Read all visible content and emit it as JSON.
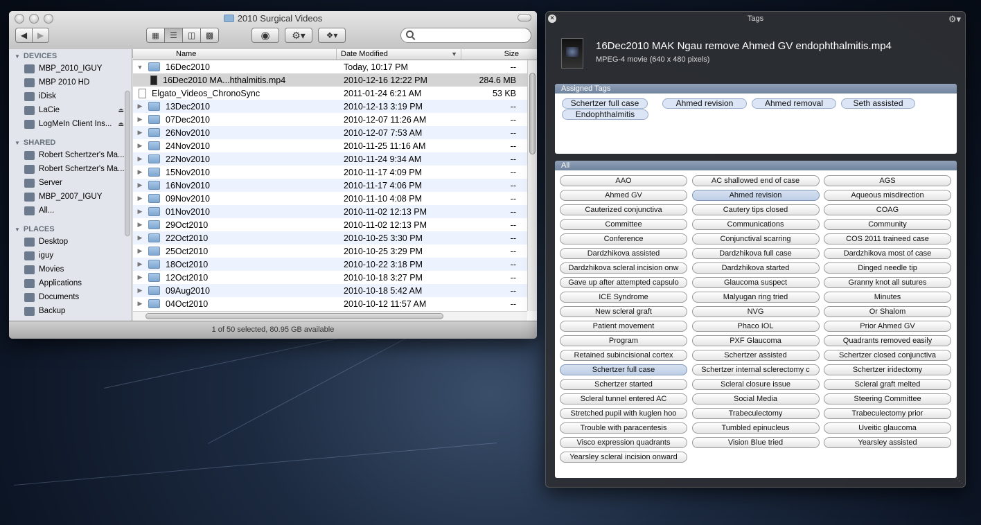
{
  "finder": {
    "title": "2010 Surgical Videos",
    "view_buttons": [
      "icon-view",
      "list-view",
      "column-view",
      "coverflow-view"
    ],
    "search_placeholder": "",
    "sidebar": {
      "devices_header": "DEVICES",
      "devices": [
        {
          "label": "MBP_2010_IGUY",
          "icon": "laptop-icon"
        },
        {
          "label": "MBP 2010 HD",
          "icon": "harddisk-icon"
        },
        {
          "label": "iDisk",
          "icon": "idisk-icon"
        },
        {
          "label": "LaCie",
          "icon": "external-disk-icon",
          "eject": true
        },
        {
          "label": "LogMeIn Client Ins...",
          "icon": "disk-image-icon",
          "eject": true
        }
      ],
      "shared_header": "SHARED",
      "shared": [
        {
          "label": "Robert Schertzer's Ma...",
          "icon": "computer-icon"
        },
        {
          "label": "Robert Schertzer's Ma...",
          "icon": "computer-icon"
        },
        {
          "label": "Server",
          "icon": "server-icon"
        },
        {
          "label": "MBP_2007_IGUY",
          "icon": "laptop-icon"
        },
        {
          "label": "All...",
          "icon": "network-icon"
        }
      ],
      "places_header": "PLACES",
      "places": [
        {
          "label": "Desktop",
          "icon": "desktop-icon"
        },
        {
          "label": "iguy",
          "icon": "home-icon"
        },
        {
          "label": "Movies",
          "icon": "movies-icon"
        },
        {
          "label": "Applications",
          "icon": "applications-icon"
        },
        {
          "label": "Documents",
          "icon": "documents-icon"
        },
        {
          "label": "Backup",
          "icon": "folder-icon"
        }
      ]
    },
    "columns": {
      "name": "Name",
      "date": "Date Modified",
      "size": "Size"
    },
    "rows": [
      {
        "name": "16Dec2010",
        "date": "Today, 10:17 PM",
        "size": "--",
        "type": "folder",
        "expanded": true
      },
      {
        "name": "16Dec2010 MA...hthalmitis.mp4",
        "date": "2010-12-16 12:22 PM",
        "size": "284.6 MB",
        "type": "movie",
        "selected": true
      },
      {
        "name": "Elgato_Videos_ChronoSync",
        "date": "2011-01-24 6:21 AM",
        "size": "53 KB",
        "type": "file"
      },
      {
        "name": "13Dec2010",
        "date": "2010-12-13 3:19 PM",
        "size": "--",
        "type": "folder"
      },
      {
        "name": "07Dec2010",
        "date": "2010-12-07 11:26 AM",
        "size": "--",
        "type": "folder"
      },
      {
        "name": "26Nov2010",
        "date": "2010-12-07 7:53 AM",
        "size": "--",
        "type": "folder"
      },
      {
        "name": "24Nov2010",
        "date": "2010-11-25 11:16 AM",
        "size": "--",
        "type": "folder"
      },
      {
        "name": "22Nov2010",
        "date": "2010-11-24 9:34 AM",
        "size": "--",
        "type": "folder"
      },
      {
        "name": "15Nov2010",
        "date": "2010-11-17 4:09 PM",
        "size": "--",
        "type": "folder"
      },
      {
        "name": "16Nov2010",
        "date": "2010-11-17 4:06 PM",
        "size": "--",
        "type": "folder"
      },
      {
        "name": "09Nov2010",
        "date": "2010-11-10 4:08 PM",
        "size": "--",
        "type": "folder"
      },
      {
        "name": "01Nov2010",
        "date": "2010-11-02 12:13 PM",
        "size": "--",
        "type": "folder"
      },
      {
        "name": "29Oct2010",
        "date": "2010-11-02 12:13 PM",
        "size": "--",
        "type": "folder"
      },
      {
        "name": "22Oct2010",
        "date": "2010-10-25 3:30 PM",
        "size": "--",
        "type": "folder"
      },
      {
        "name": "25Oct2010",
        "date": "2010-10-25 3:29 PM",
        "size": "--",
        "type": "folder"
      },
      {
        "name": "18Oct2010",
        "date": "2010-10-22 3:18 PM",
        "size": "--",
        "type": "folder"
      },
      {
        "name": "12Oct2010",
        "date": "2010-10-18 3:27 PM",
        "size": "--",
        "type": "folder"
      },
      {
        "name": "09Aug2010",
        "date": "2010-10-18 5:42 AM",
        "size": "--",
        "type": "folder"
      },
      {
        "name": "04Oct2010",
        "date": "2010-10-12 11:57 AM",
        "size": "--",
        "type": "folder"
      }
    ],
    "status": "1 of 50 selected, 80.95 GB available"
  },
  "tags_panel": {
    "title": "Tags",
    "file_name": "16Dec2010 MAK Ngau remove Ahmed GV endophthalmitis.mp4",
    "file_type": "MPEG-4 movie (640 x 480 pixels)",
    "assigned_header": "Assigned Tags",
    "assigned": [
      "Schertzer full case",
      "Ahmed revision",
      "Ahmed removal",
      "Seth assisted",
      "Endophthalmitis"
    ],
    "all_header": "All",
    "all_tags": [
      "AAO",
      "AC shallowed end of case",
      "AGS",
      "Ahmed GV",
      "Ahmed revision",
      "Aqueous misdirection",
      "Cauterized conjunctiva",
      "Cautery tips closed",
      "COAG",
      "Committee",
      "Communications",
      "Community",
      "Conference",
      "Conjunctival scarring",
      "COS 2011 traineed case",
      "Dardzhikova assisted",
      "Dardzhikova full case",
      "Dardzhikova most of case",
      "Dardzhikova scleral incision onw",
      "Dardzhikova started",
      "Dinged needle tip",
      "Gave up after attempted capsulo",
      "Glaucoma suspect",
      "Granny knot all sutures",
      "ICE Syndrome",
      "Malyugan ring tried",
      "Minutes",
      "New scleral graft",
      "NVG",
      "Or Shalom",
      "Patient movement",
      "Phaco IOL",
      "Prior Ahmed GV",
      "Program",
      "PXF Glaucoma",
      "Quadrants removed easily",
      "Retained subincisional cortex",
      "Schertzer assisted",
      "Schertzer closed conjunctiva",
      "Schertzer full case",
      "Schertzer internal sclerectomy c",
      "Schertzer iridectomy",
      "Schertzer started",
      "Scleral closure issue",
      "Scleral graft melted",
      "Scleral tunnel entered AC",
      "Social Media",
      "Steering Committee",
      "Stretched pupil with kuglen hoo",
      "Trabeculectomy",
      "Trabeculectomy prior",
      "Trouble with paracentesis",
      "Tumbled epinucleus",
      "Uveitic glaucoma",
      "Visco expression quadrants",
      "Vision Blue tried",
      "Yearsley assisted",
      "Yearsley scleral incision onward"
    ],
    "selected_tags": [
      "Ahmed revision",
      "Schertzer full case"
    ]
  }
}
